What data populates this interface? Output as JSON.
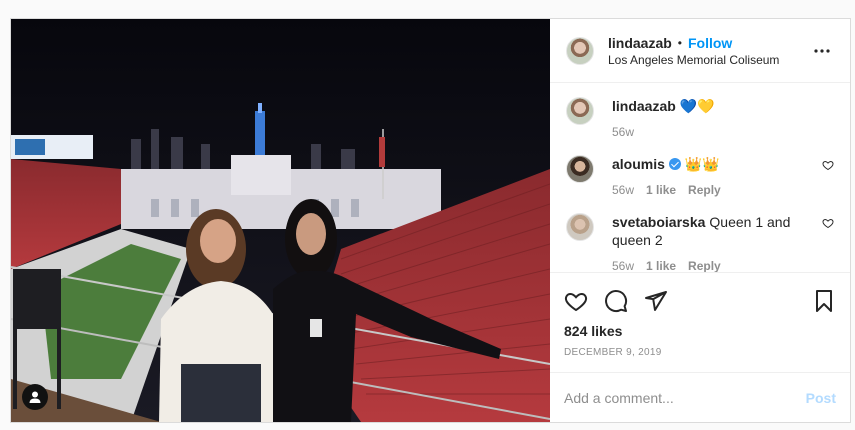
{
  "post": {
    "author": "lindaazab",
    "follow_label": "Follow",
    "location": "Los Angeles Memorial Coliseum",
    "menu_icon": "more-horizontal-icon",
    "likes": "824 likes",
    "date": "DECEMBER 9, 2019",
    "add_comment_placeholder": "Add a comment...",
    "post_label": "Post"
  },
  "comments": [
    {
      "user": "lindaazab",
      "text": "💙💛",
      "time": "56w",
      "verified": false
    },
    {
      "user": "aloumis",
      "text": "👑👑",
      "time": "56w",
      "likes": "1 like",
      "reply": "Reply",
      "verified": true
    },
    {
      "user": "svetaboiarska",
      "text": "Queen 1 and queen 2",
      "time": "56w",
      "likes": "1 like",
      "reply": "Reply",
      "verified": false
    }
  ],
  "colors": {
    "link": "#0095f6",
    "muted": "#8e8e8e",
    "post_disabled": "#b3dbff",
    "verified": "#3897f0"
  }
}
